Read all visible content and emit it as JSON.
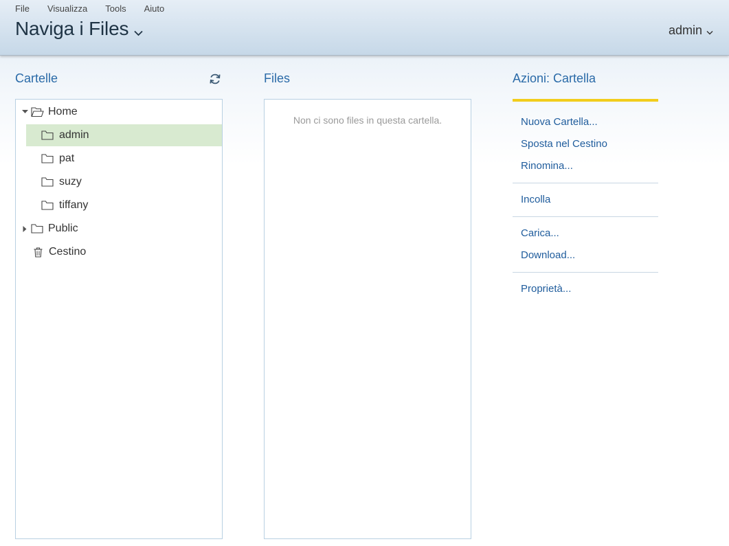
{
  "menubar": {
    "items": [
      "File",
      "Visualizza",
      "Tools",
      "Aiuto"
    ]
  },
  "header": {
    "perspective_title": "Naviga i Files",
    "user_name": "admin"
  },
  "folders_panel": {
    "title": "Cartelle",
    "tree": [
      {
        "label": "Home",
        "icon": "folder-open-icon",
        "expanded": true
      },
      {
        "label": "admin",
        "icon": "folder-icon",
        "selected": true
      },
      {
        "label": "pat",
        "icon": "folder-icon"
      },
      {
        "label": "suzy",
        "icon": "folder-icon"
      },
      {
        "label": "tiffany",
        "icon": "folder-icon"
      },
      {
        "label": "Public",
        "icon": "folder-icon",
        "expanded": false
      },
      {
        "label": "Cestino",
        "icon": "trash-icon"
      }
    ]
  },
  "files_panel": {
    "title": "Files",
    "empty_message": "Non ci sono files in questa cartella."
  },
  "actions_panel": {
    "title": "Azioni: Cartella",
    "accent_color": "#f2cd1c",
    "groups": [
      [
        "Nuova Cartella...",
        "Sposta nel Cestino",
        "Rinomina..."
      ],
      [
        "Incolla"
      ],
      [
        "Carica...",
        "Download..."
      ],
      [
        "Proprietà..."
      ]
    ]
  },
  "colors": {
    "link": "#1f5c9c",
    "panel_title": "#2a6aa8",
    "selected_row": "#d8ead0",
    "border": "#b8d0e2"
  }
}
